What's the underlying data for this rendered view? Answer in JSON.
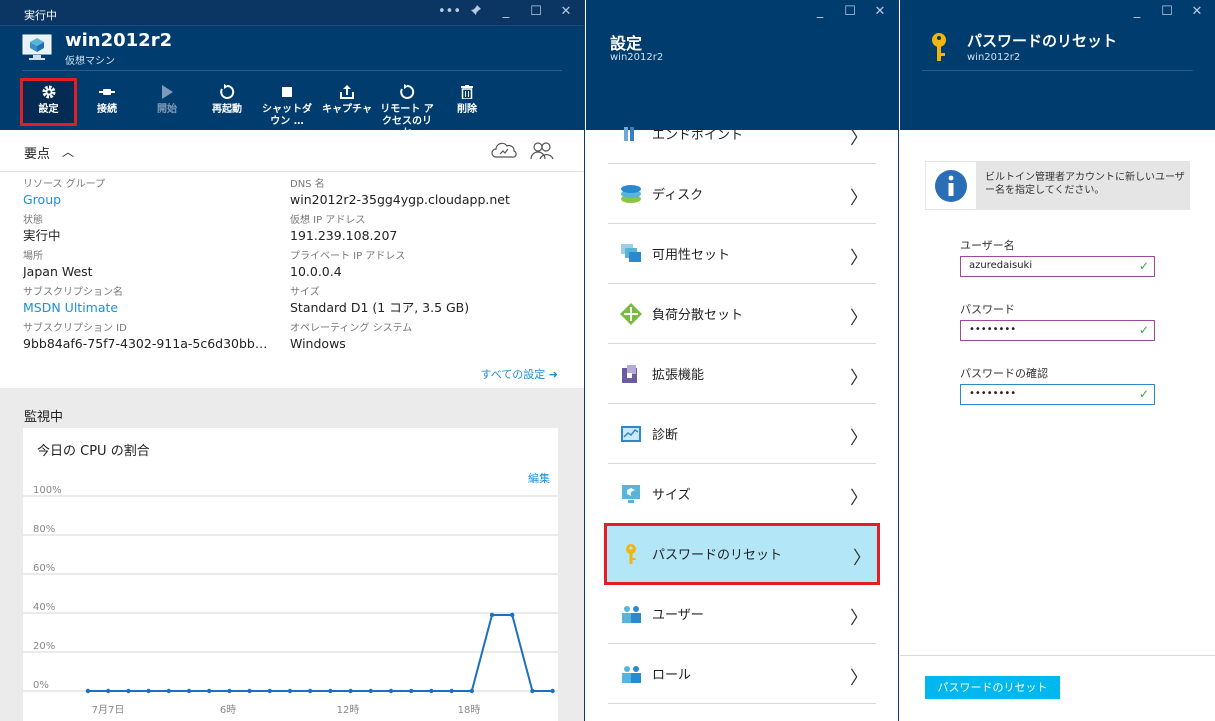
{
  "blade1": {
    "status": "実行中",
    "title": "win2012r2",
    "subtitle": "仮想マシン",
    "toolbar": [
      {
        "label": "設定",
        "icon": "gear-icon"
      },
      {
        "label": "接続",
        "icon": "plug-icon"
      },
      {
        "label": "開始",
        "icon": "play-icon"
      },
      {
        "label": "再起動",
        "icon": "restart-icon"
      },
      {
        "label": "シャットダウン …",
        "icon": "stop-icon"
      },
      {
        "label": "キャプチャ",
        "icon": "upload-icon"
      },
      {
        "label": "リモート アクセスのリセ",
        "icon": "reset-icon"
      },
      {
        "label": "削除",
        "icon": "trash-icon"
      }
    ],
    "essentials": {
      "title": "要点",
      "left": [
        {
          "key": "リソース グループ",
          "value": "Group"
        },
        {
          "key": "状態",
          "value": "実行中"
        },
        {
          "key": "場所",
          "value": "Japan West"
        },
        {
          "key": "サブスクリプション名",
          "value": "MSDN Ultimate"
        },
        {
          "key": "サブスクリプション ID",
          "value": "9bb84af6-75f7-4302-911a-5c6d30bb…"
        }
      ],
      "right": [
        {
          "key": "DNS 名",
          "value": "win2012r2-35gg4ygp.cloudapp.net"
        },
        {
          "key": "仮想 IP アドレス",
          "value": "191.239.108.207"
        },
        {
          "key": "プライベート IP アドレス",
          "value": "10.0.0.4"
        },
        {
          "key": "サイズ",
          "value": "Standard D1 (1 コア, 3.5 GB)"
        },
        {
          "key": "オペレーティング システム",
          "value": "Windows"
        }
      ],
      "all_settings": "すべての設定 ➜"
    },
    "monitoring": {
      "title": "監視中",
      "card_title": "今日の CPU の割合",
      "edit": "編集"
    }
  },
  "chart_data": {
    "type": "line",
    "title": "今日の CPU の割合",
    "yticks": [
      "100%",
      "80%",
      "60%",
      "40%",
      "20%",
      "0%"
    ],
    "ylim": [
      0,
      100
    ],
    "xticks": [
      "7月7日",
      "6時",
      "12時",
      "18時"
    ],
    "series": [
      {
        "values": [
          0,
          0,
          0,
          0,
          0,
          0,
          0,
          0,
          0,
          0,
          0,
          0,
          0,
          0,
          0,
          0,
          0,
          0,
          0,
          0,
          39,
          39,
          0,
          0
        ]
      }
    ],
    "color": "#1f6fbf"
  },
  "blade2": {
    "title": "設定",
    "subtitle": "win2012r2",
    "items": [
      {
        "label": "エンドポイント"
      },
      {
        "label": "ディスク"
      },
      {
        "label": "可用性セット"
      },
      {
        "label": "負荷分散セット"
      },
      {
        "label": "拡張機能"
      },
      {
        "label": "診断"
      },
      {
        "label": "サイズ"
      },
      {
        "label": "パスワードのリセット"
      },
      {
        "label": "ユーザー"
      },
      {
        "label": "ロール"
      }
    ]
  },
  "blade3": {
    "title": "パスワードのリセット",
    "subtitle": "win2012r2",
    "info": "ビルトイン管理者アカウントに新しいユーザー名を指定してください。",
    "username_label": "ユーザー名",
    "username_value": "azuredaisuki",
    "password_label": "パスワード",
    "password_value": "••••••••",
    "confirm_label": "パスワードの確認",
    "confirm_value": "••••••••",
    "button": "パスワードのリセット"
  },
  "window_controls": {
    "more": "•••",
    "pin": "✕",
    "min": "_",
    "max": "☐",
    "close": "✕"
  }
}
